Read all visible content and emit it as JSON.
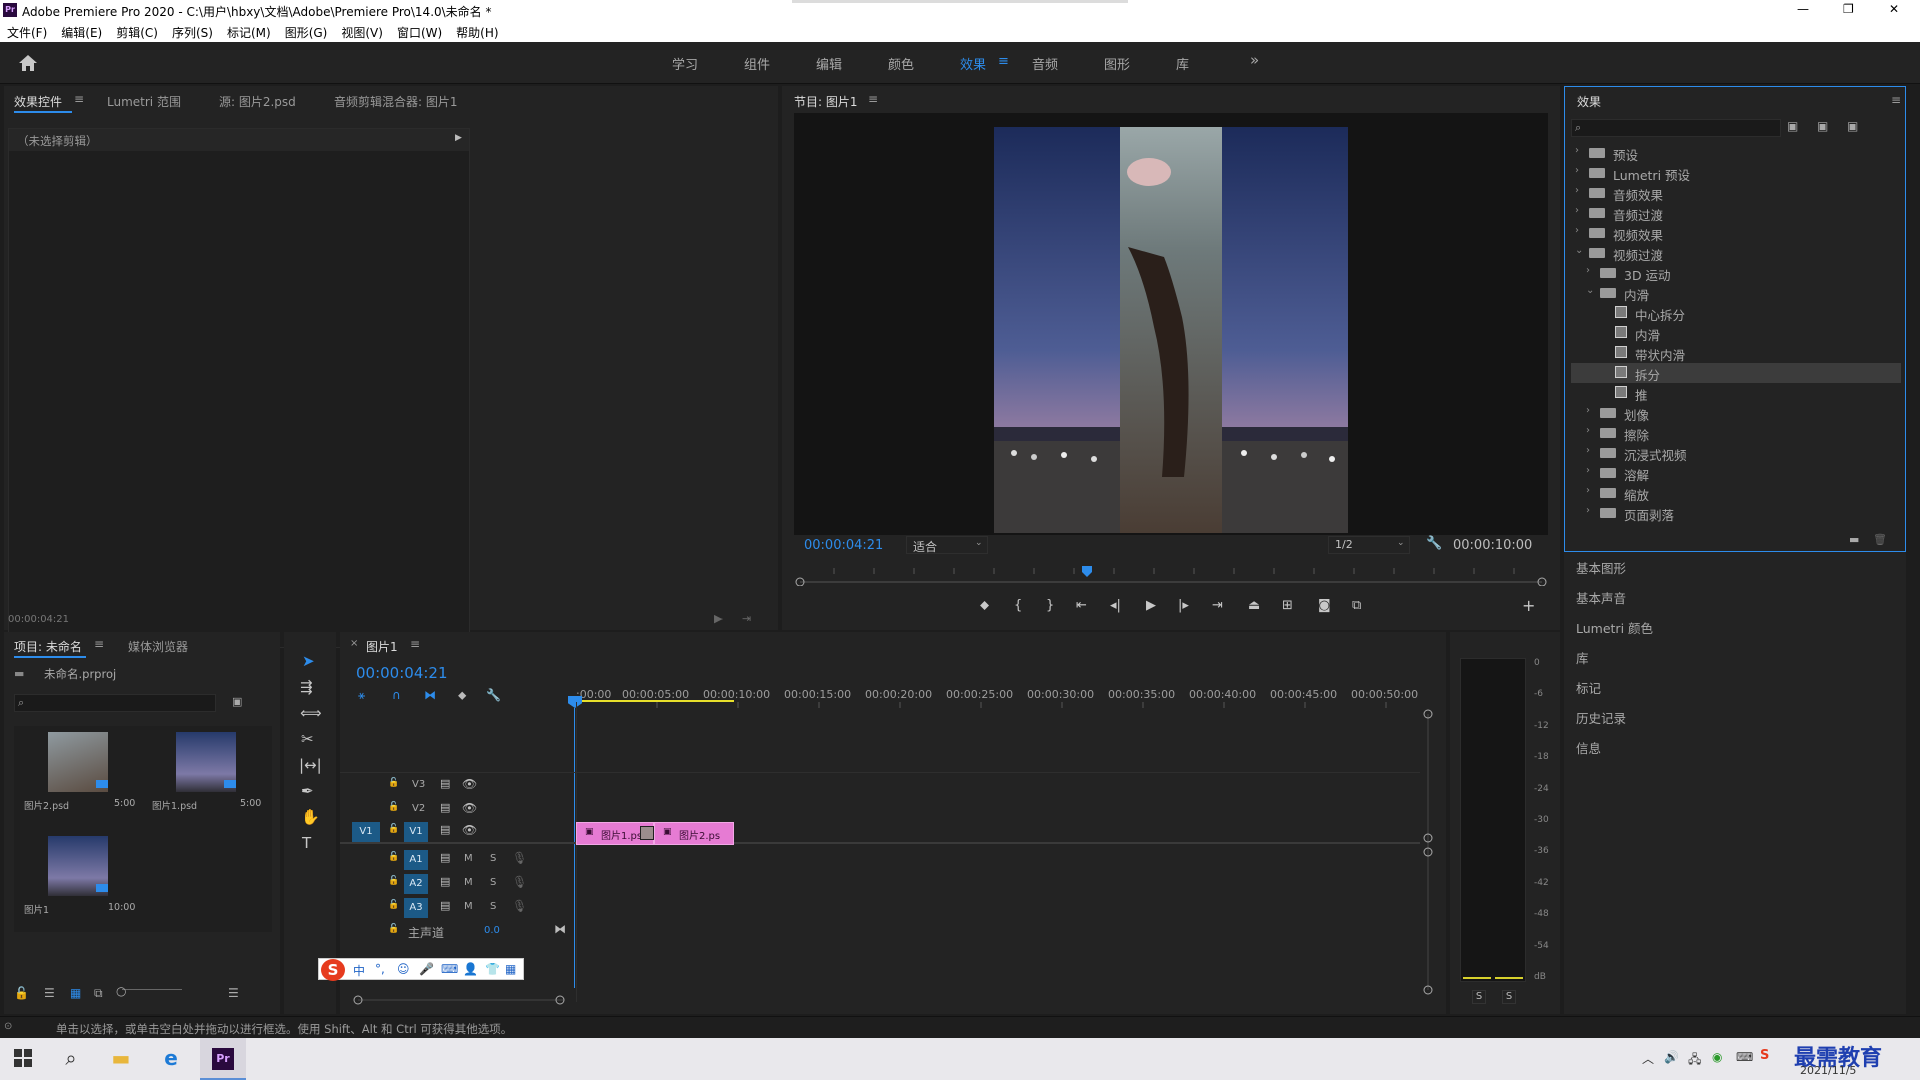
{
  "app": {
    "title": "Adobe Premiere Pro 2020 - C:\\用户\\hbxy\\文档\\Adobe\\Premiere Pro\\14.0\\未命名 *",
    "icon_text": "Pr"
  },
  "window_controls": {
    "minimize": "—",
    "maximize": "❐",
    "close": "✕"
  },
  "menu": [
    "文件(F)",
    "编辑(E)",
    "剪辑(C)",
    "序列(S)",
    "标记(M)",
    "图形(G)",
    "视图(V)",
    "窗口(W)",
    "帮助(H)"
  ],
  "workspaces": {
    "items": [
      "学习",
      "组件",
      "编辑",
      "颜色",
      "效果",
      "音频",
      "图形",
      "库"
    ],
    "active": "效果",
    "more": "»",
    "menu_icon": "≡"
  },
  "effect_controls": {
    "tabs": [
      "效果控件",
      "Lumetri 范围",
      "源: 图片2.psd",
      "音频剪辑混合器: 图片1"
    ],
    "no_clip": "（未选择剪辑）",
    "timecode": "00:00:04:21"
  },
  "program": {
    "title": "节目: 图片1",
    "timecode": "00:00:04:21",
    "fit": "适合",
    "resolution": "1/2",
    "duration": "00:00:10:00"
  },
  "project": {
    "tabs": [
      "项目: 未命名",
      "媒体浏览器"
    ],
    "file": "未命名.prproj",
    "items": [
      {
        "name": "图片2.psd",
        "dur": "5:00"
      },
      {
        "name": "图片1.psd",
        "dur": "5:00"
      },
      {
        "name": "图片1",
        "dur": "10:00"
      }
    ]
  },
  "timeline": {
    "tab": "图片1",
    "timecode": "00:00:04:21",
    "ruler": [
      ":00:00",
      "00:00:05:00",
      "00:00:10:00",
      "00:00:15:00",
      "00:00:20:00",
      "00:00:25:00",
      "00:00:30:00",
      "00:00:35:00",
      "00:00:40:00",
      "00:00:45:00",
      "00:00:50:00"
    ],
    "tracks": {
      "v3": "V3",
      "v2": "V2",
      "v1": "V1",
      "src_v1": "V1",
      "a1": "A1",
      "a2": "A2",
      "a3": "A3",
      "m": "M",
      "s": "S"
    },
    "master": "主声道",
    "master_val": "0.0",
    "clips": {
      "c1": "图片1.ps",
      "c2": "图片2.ps"
    }
  },
  "effects": {
    "title": "效果",
    "tree": [
      {
        "label": "预设",
        "level": 0
      },
      {
        "label": "Lumetri 预设",
        "level": 0
      },
      {
        "label": "音频效果",
        "level": 0
      },
      {
        "label": "音频过渡",
        "level": 0
      },
      {
        "label": "视频效果",
        "level": 0
      },
      {
        "label": "视频过渡",
        "level": 0,
        "open": true
      },
      {
        "label": "3D 运动",
        "level": 1
      },
      {
        "label": "内滑",
        "level": 1,
        "open": true
      },
      {
        "label": "中心拆分",
        "level": 2
      },
      {
        "label": "内滑",
        "level": 2
      },
      {
        "label": "带状内滑",
        "level": 2
      },
      {
        "label": "拆分",
        "level": 2,
        "selected": true
      },
      {
        "label": "推",
        "level": 2
      },
      {
        "label": "划像",
        "level": 1
      },
      {
        "label": "擦除",
        "level": 1
      },
      {
        "label": "沉浸式视频",
        "level": 1
      },
      {
        "label": "溶解",
        "level": 1
      },
      {
        "label": "缩放",
        "level": 1
      },
      {
        "label": "页面剥落",
        "level": 1
      }
    ]
  },
  "side_panels": [
    "基本图形",
    "基本声音",
    "Lumetri 颜色",
    "库",
    "标记",
    "历史记录",
    "信息"
  ],
  "meter": {
    "ticks": [
      "0",
      "-6",
      "-12",
      "-18",
      "-24",
      "-30",
      "-36",
      "-42",
      "-48",
      "-54",
      "dB"
    ],
    "solo": [
      "S",
      "S"
    ]
  },
  "status": "单击以选择，或单击空白处并拖动以进行框选。使用 Shift、Alt 和 Ctrl 可获得其他选项。",
  "ime": {
    "logo": "S",
    "lang": "中"
  },
  "tray": {
    "date": "2021/11/5",
    "watermark": "最需教育"
  },
  "colors": {
    "accent": "#2d8ceb",
    "clip": "#e67bd3",
    "track_blue": "#1c5a87"
  }
}
